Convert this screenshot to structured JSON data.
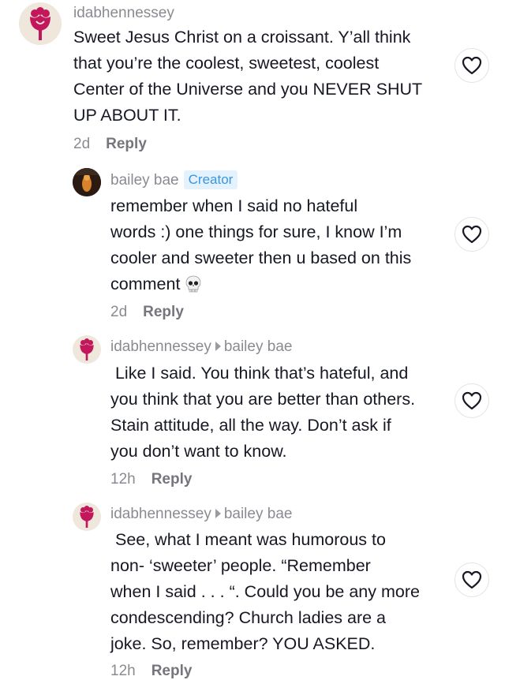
{
  "comments": [
    {
      "username": "idabhennessey",
      "lines": [
        "Sweet Jesus Christ on a croissant. Y’all think",
        "that you’re the coolest, sweetest, coolest",
        "Center of the Universe and you NEVER SHUT",
        "UP ABOUT IT."
      ],
      "time": "2d",
      "reply_label": "Reply",
      "avatar": "flower-avatar"
    },
    {
      "username": "bailey bae",
      "badge": "Creator",
      "lines": [
        "remember when I said no hateful",
        "words :) one things for sure, I know I’m",
        "cooler and sweeter then u based on this",
        "comment"
      ],
      "emoji": "skull-icon",
      "time": "2d",
      "reply_label": "Reply",
      "avatar": "photo-avatar"
    },
    {
      "username": "idabhennessey",
      "reply_to": "bailey bae",
      "lines": [
        " Like I said. You think that’s hateful, and",
        "you think that you are better than others.",
        "Stain attitude, all the way. Don’t ask if",
        "you don’t want to know."
      ],
      "time": "12h",
      "reply_label": "Reply",
      "avatar": "flower-avatar"
    },
    {
      "username": "idabhennessey",
      "reply_to": "bailey bae",
      "lines": [
        " See, what I meant was humorous to",
        "non- ‘sweeter’ people. “Remember",
        "when I said . . . “. Could you be any more",
        "condescending? Church ladies are a",
        "joke. So, remember? YOU ASKED."
      ],
      "time": "12h",
      "reply_label": "Reply",
      "avatar": "flower-avatar"
    }
  ],
  "colors": {
    "creator_badge": "#3a96e0",
    "badge_bg": "#e3f2fd",
    "flower": "#c2185b"
  }
}
